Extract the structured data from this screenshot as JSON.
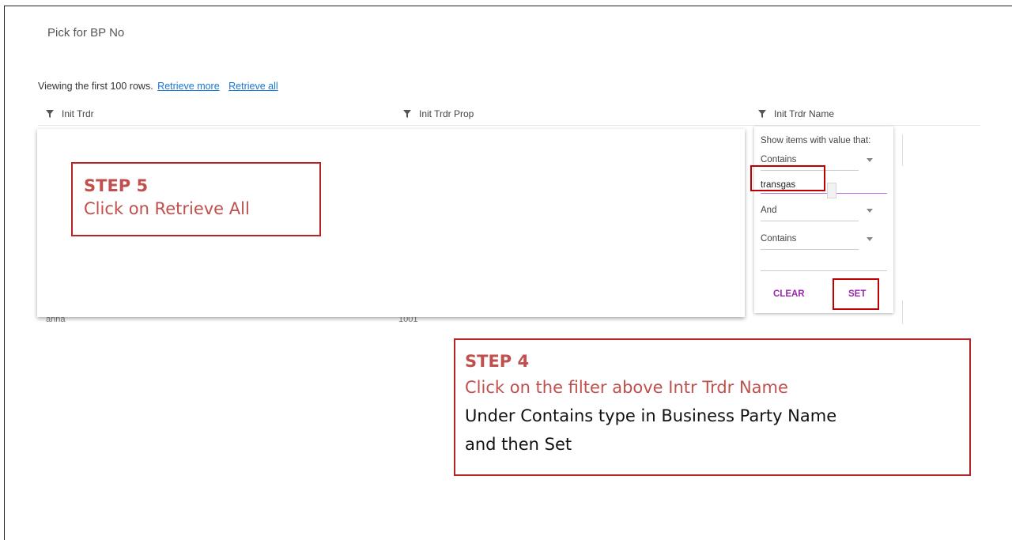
{
  "page": {
    "title": "Pick for BP No"
  },
  "results": {
    "viewing_text": "Viewing the first 100 rows.",
    "retrieve_more": "Retrieve more",
    "retrieve_all": "Retrieve all"
  },
  "columns": [
    {
      "label": "Init Trdr"
    },
    {
      "label": "Init Trdr Prop"
    },
    {
      "label": "Init Trdr Name"
    }
  ],
  "peek_text": {
    "col1": "anna",
    "col2": "1001"
  },
  "filter_popup": {
    "label": "Show items with value that:",
    "condition1": "Contains",
    "value1": "transgas",
    "operator": "And",
    "condition2": "Contains",
    "value2": "",
    "clear_label": "CLEAR",
    "set_label": "SET"
  },
  "callouts": {
    "step5": {
      "heading": "STEP 5",
      "text": "Click on Retrieve All"
    },
    "step4": {
      "heading": "STEP 4",
      "line1": "Click on the filter above Intr Trdr Name",
      "line2": "Under Contains type in Business Party Name",
      "line3": "and then Set"
    }
  },
  "colors": {
    "callout_border": "#b82425",
    "callout_text": "#c0504d",
    "link": "#1976d2",
    "accent_purple": "#9c27b0"
  }
}
